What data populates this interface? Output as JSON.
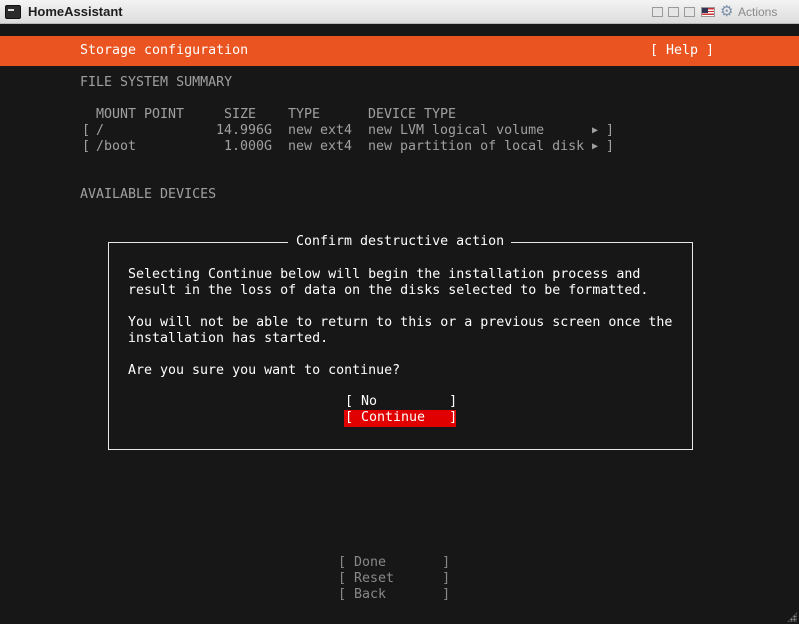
{
  "window": {
    "title": "HomeAssistant",
    "actions_label": "Actions",
    "icons": [
      "terminal-icon",
      "window-btn",
      "window-btn",
      "window-btn",
      "us-flag-icon",
      "gear-icon"
    ]
  },
  "header": {
    "title": "Storage configuration",
    "help_label": "[ Help ]",
    "accent_color": "#e95420"
  },
  "fs_summary": {
    "heading": "FILE SYSTEM SUMMARY",
    "columns": {
      "mount_point": "MOUNT POINT",
      "size": "SIZE",
      "type": "TYPE",
      "device_type": "DEVICE TYPE"
    },
    "rows": [
      {
        "bracket": "[",
        "mount": "/",
        "size": "14.996G",
        "type": "new ext4",
        "device_type": "new LVM logical volume",
        "arrow": "▶",
        "end": "]"
      },
      {
        "bracket": "[",
        "mount": "/boot",
        "size": "1.000G",
        "type": "new ext4",
        "device_type": "new partition of local disk",
        "arrow": "▶",
        "end": "]"
      }
    ]
  },
  "available_devices": {
    "heading": "AVAILABLE DEVICES"
  },
  "dialog": {
    "title": "Confirm destructive action",
    "lines": [
      "Selecting Continue below will begin the installation process and",
      "result in the loss of data on the disks selected to be formatted.",
      "You will not be able to return to this or a previous screen once the",
      "installation has started.",
      "Are you sure you want to continue?"
    ],
    "no_label": "[ No         ]",
    "continue_label": "[ Continue   ]",
    "selected": "Continue",
    "selected_color": "#e00000"
  },
  "bottom_buttons": {
    "done": "[ Done       ]",
    "reset": "[ Reset      ]",
    "back": "[ Back       ]"
  }
}
